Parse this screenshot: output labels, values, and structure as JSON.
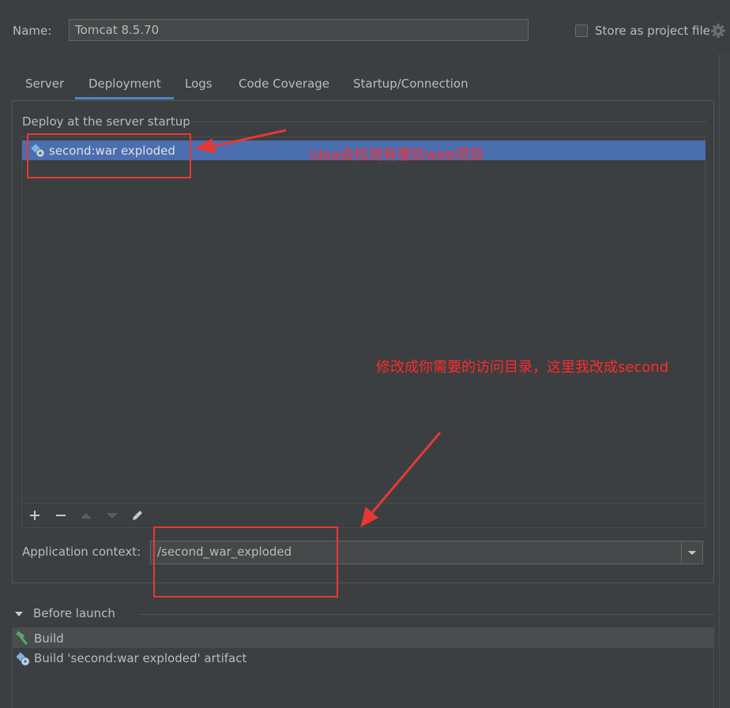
{
  "header": {
    "name_label": "Name:",
    "name_value": "Tomcat 8.5.70",
    "store_label": "Store as project file",
    "store_checked": false
  },
  "tabs": [
    {
      "label": "Server",
      "active": false
    },
    {
      "label": "Deployment",
      "active": true
    },
    {
      "label": "Logs",
      "active": false
    },
    {
      "label": "Code Coverage",
      "active": false
    },
    {
      "label": "Startup/Connection",
      "active": false
    }
  ],
  "deploy": {
    "title": "Deploy at the server startup",
    "items": [
      {
        "label": "second:war exploded",
        "icon": "artifact-icon",
        "selected": true
      }
    ],
    "toolbar": [
      "add-icon",
      "remove-icon",
      "move-up-icon",
      "move-down-icon",
      "edit-icon"
    ]
  },
  "context": {
    "label": "Application context:",
    "value": "/second_war_exploded"
  },
  "before_launch": {
    "title": "Before launch",
    "items": [
      {
        "label": "Build",
        "icon": "hammer-icon"
      },
      {
        "label": "Build 'second:war exploded' artifact",
        "icon": "artifact-icon"
      }
    ]
  },
  "annotations": {
    "note_1": "idea会检测有哪些web项目",
    "note_2": "修改成你需要的访问目录，这里我改成second",
    "color": "#e53935"
  },
  "colors": {
    "background": "#3c3f41",
    "selection": "#4b6eaf",
    "tab_underline": "#4a88c7",
    "text": "#bbbbbb"
  }
}
